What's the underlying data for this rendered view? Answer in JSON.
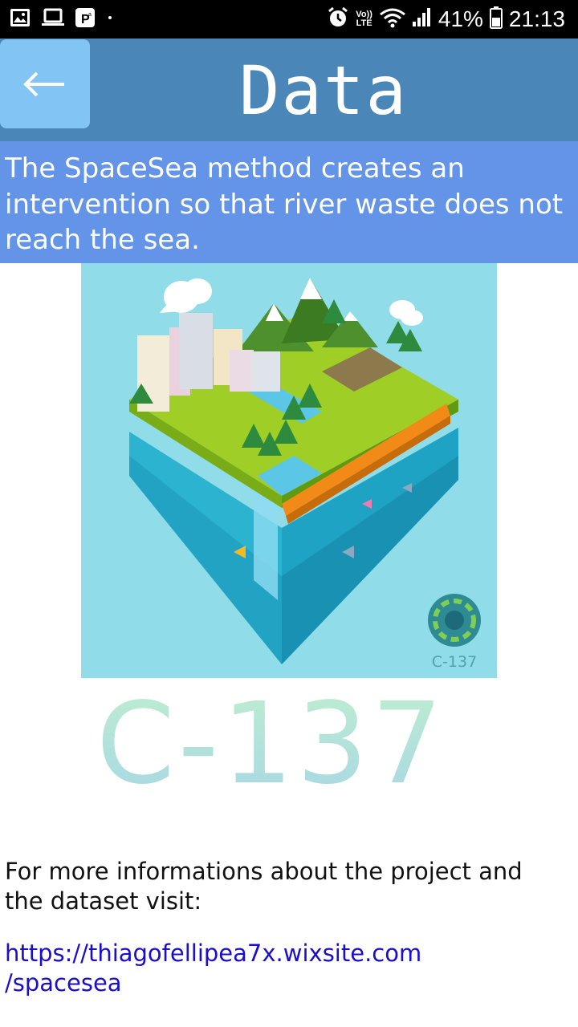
{
  "status_bar": {
    "battery": "41%",
    "time": "21:13",
    "volte_top": "Vo))",
    "volte_bottom": "LTE",
    "icons": [
      "image-icon",
      "laptop-icon",
      "parking-icon",
      "dot-icon",
      "alarm-icon",
      "volte-icon",
      "wifi-icon",
      "signal-icon",
      "battery-icon"
    ]
  },
  "header": {
    "title": "Data",
    "back_icon": "arrow-left-icon"
  },
  "banner": {
    "text": "The SpaceSea method creates an intervention so that river waste does not reach the sea."
  },
  "illustration": {
    "badge_text": "C-137"
  },
  "logo": {
    "text": "C-137"
  },
  "info": {
    "text": "For more informations about the project and the dataset visit:",
    "link_line1": "https://thiagofellipea7x.wixsite.com",
    "link_line2": "/spacesea"
  },
  "colors": {
    "status_bar": "#000000",
    "app_bar": "#4a86b8",
    "back_button": "#82c4f4",
    "banner": "#6494e8",
    "illustration_bg": "#90dde9",
    "link": "#1a0dcc"
  }
}
